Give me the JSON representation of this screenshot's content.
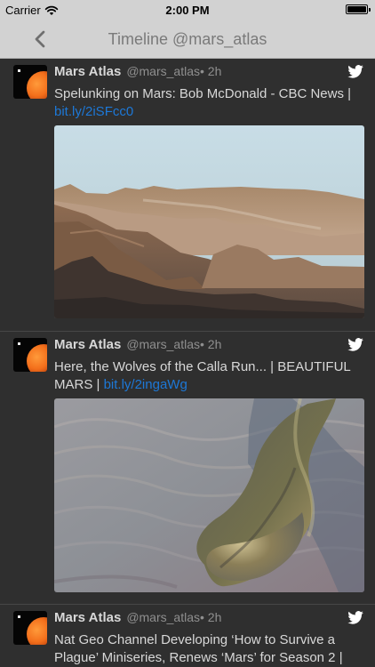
{
  "status_bar": {
    "carrier": "Carrier",
    "time": "2:00 PM",
    "battery_level": 1.0
  },
  "nav": {
    "back_icon": "chevron-left-icon",
    "title": "Timeline @mars_atlas"
  },
  "tweets": [
    {
      "author": "Mars Atlas",
      "handle": "@mars_atlas",
      "time": " • 2h",
      "text": "Spelunking on Mars: Bob McDonald - CBC News | ",
      "link": "bit.ly/2iSFcc0",
      "media": "mars-mountain-landscape-image"
    },
    {
      "author": "Mars Atlas",
      "handle": "@mars_atlas",
      "time": " • 2h",
      "text": "Here, the Wolves of the Calla Run... | BEAUTIFUL MARS | ",
      "link": "bit.ly/2ingaWg",
      "media": "mars-surface-dunes-image"
    },
    {
      "author": "Mars Atlas",
      "handle": "@mars_atlas",
      "time": " • 2h",
      "text": "Nat Geo Channel Developing ‘How to Survive a Plague’ Miniseries, Renews ‘Mars’ for Season 2 |",
      "link": ""
    }
  ],
  "colors": {
    "background": "#2f2f2f",
    "nav_background": "#d2d2d2",
    "link": "#1d78d7",
    "twitter_icon": "#ffffff"
  }
}
